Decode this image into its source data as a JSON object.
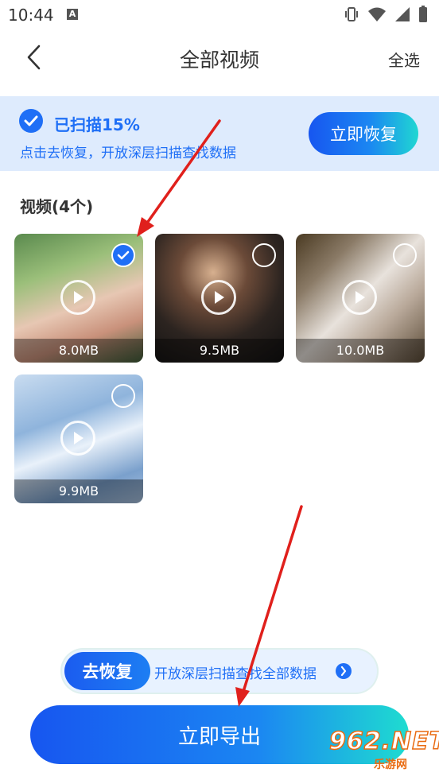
{
  "status_bar": {
    "time": "10:44",
    "notification_letter": "A",
    "icons": [
      "vibrate-icon",
      "wifi-icon",
      "signal-icon",
      "battery-icon"
    ]
  },
  "header": {
    "title": "全部视频",
    "select_all_label": "全选",
    "back_icon": "chevron-left-icon"
  },
  "scan_banner": {
    "title": "已扫描15%",
    "subtitle": "点击去恢复，开放深层扫描查找数据",
    "button_label": "立即恢复",
    "progress_percent": 15
  },
  "video_section": {
    "title": "视频(4个)",
    "items": [
      {
        "size": "8.0MB",
        "selected": true
      },
      {
        "size": "9.5MB",
        "selected": false
      },
      {
        "size": "10.0MB",
        "selected": false
      },
      {
        "size": "9.9MB",
        "selected": false
      }
    ]
  },
  "promo": {
    "button_label": "去恢复",
    "text": "开放深层扫描查找全部数据"
  },
  "export_button_label": "立即导出",
  "watermark": {
    "logo": "962.NET",
    "sub": "乐游网"
  },
  "colors": {
    "accent": "#1f6ff6",
    "banner_bg": "#deebfd",
    "annotation_arrow": "#e0201c"
  }
}
